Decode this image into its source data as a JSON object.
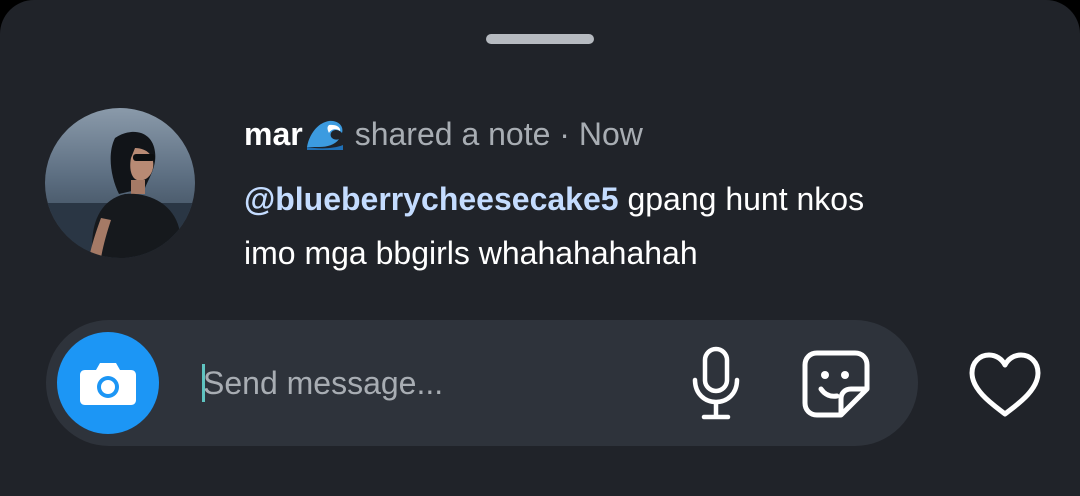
{
  "sheet": {
    "colors": {
      "background": "#202329",
      "composer": "#2e333b",
      "accent_blue": "#1c96f5",
      "mention": "#c4dcff",
      "muted_text": "#a8adb3"
    }
  },
  "note": {
    "author": "mar",
    "author_emoji": "wave-icon",
    "action": "shared a note",
    "separator": " · ",
    "time": "Now",
    "mention": "@blueberrycheesecake5",
    "body": " gpang hunt nkos",
    "body_line2": "imo mga bbgirls whahahahahah"
  },
  "composer": {
    "camera_icon": "camera-icon",
    "placeholder": "Send message...",
    "value": "",
    "mic_icon": "microphone-icon",
    "sticker_icon": "sticker-icon"
  },
  "actions": {
    "like_icon": "heart-icon"
  }
}
